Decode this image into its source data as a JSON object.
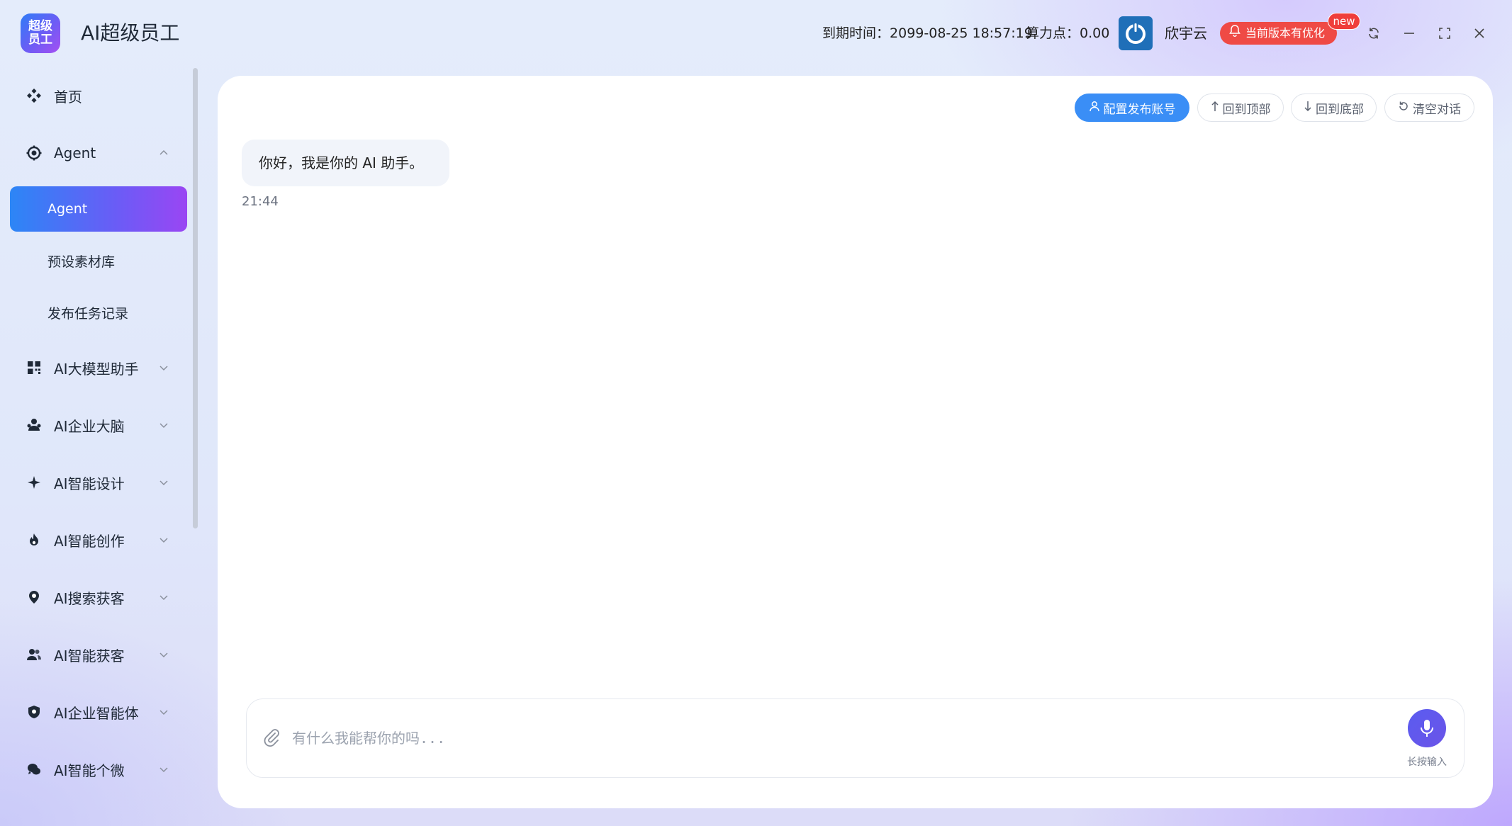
{
  "app": {
    "logo_text": "超级员工",
    "title": "AI超级员工"
  },
  "titlebar": {
    "expire_label": "到期时间：",
    "expire_value": "2099-08-25 18:57:19",
    "points_label": "算力点：",
    "points_value": "0.00",
    "provider_name": "欣宇云",
    "update_label": "当前版本有优化",
    "new_badge": "new",
    "window_icons": [
      "refresh-icon",
      "minimize-icon",
      "maximize-icon",
      "close-icon"
    ]
  },
  "sidebar": {
    "items": [
      {
        "label": "首页",
        "icon": "home-icon",
        "has_chevron": false
      },
      {
        "label": "Agent",
        "icon": "agent-icon",
        "has_chevron": true,
        "expanded": true
      },
      {
        "label": "AI大模型助手",
        "icon": "model-icon",
        "has_chevron": true
      },
      {
        "label": "AI企业大脑",
        "icon": "brain-icon",
        "has_chevron": true
      },
      {
        "label": "AI智能设计",
        "icon": "design-icon",
        "has_chevron": true
      },
      {
        "label": "AI智能创作",
        "icon": "fire-icon",
        "has_chevron": true
      },
      {
        "label": "AI搜索获客",
        "icon": "location-icon",
        "has_chevron": true
      },
      {
        "label": "AI智能获客",
        "icon": "users-icon",
        "has_chevron": true
      },
      {
        "label": "AI企业智能体",
        "icon": "shield-icon",
        "has_chevron": true
      },
      {
        "label": "AI智能个微",
        "icon": "chat-icon",
        "has_chevron": true
      }
    ],
    "subitems": [
      {
        "label": "Agent",
        "active": true
      },
      {
        "label": "预设素材库",
        "active": false
      },
      {
        "label": "发布任务记录",
        "active": false
      }
    ]
  },
  "main": {
    "toolbar": {
      "config_label": "配置发布账号",
      "top_label": "回到顶部",
      "bottom_label": "回到底部",
      "clear_label": "清空对话"
    },
    "messages": [
      {
        "text": "你好，我是你的 AI 助手。",
        "time": "21:44"
      }
    ],
    "composer": {
      "placeholder": "有什么我能帮你的吗...",
      "value": "",
      "mic_label": "长按输入"
    }
  },
  "colors": {
    "accent": "#3a8ef6",
    "active_gradient_start": "#2c86f6",
    "active_gradient_end": "#9a46f3",
    "update_red": "#ef4a45",
    "mic_purple": "#5a5cf0"
  }
}
